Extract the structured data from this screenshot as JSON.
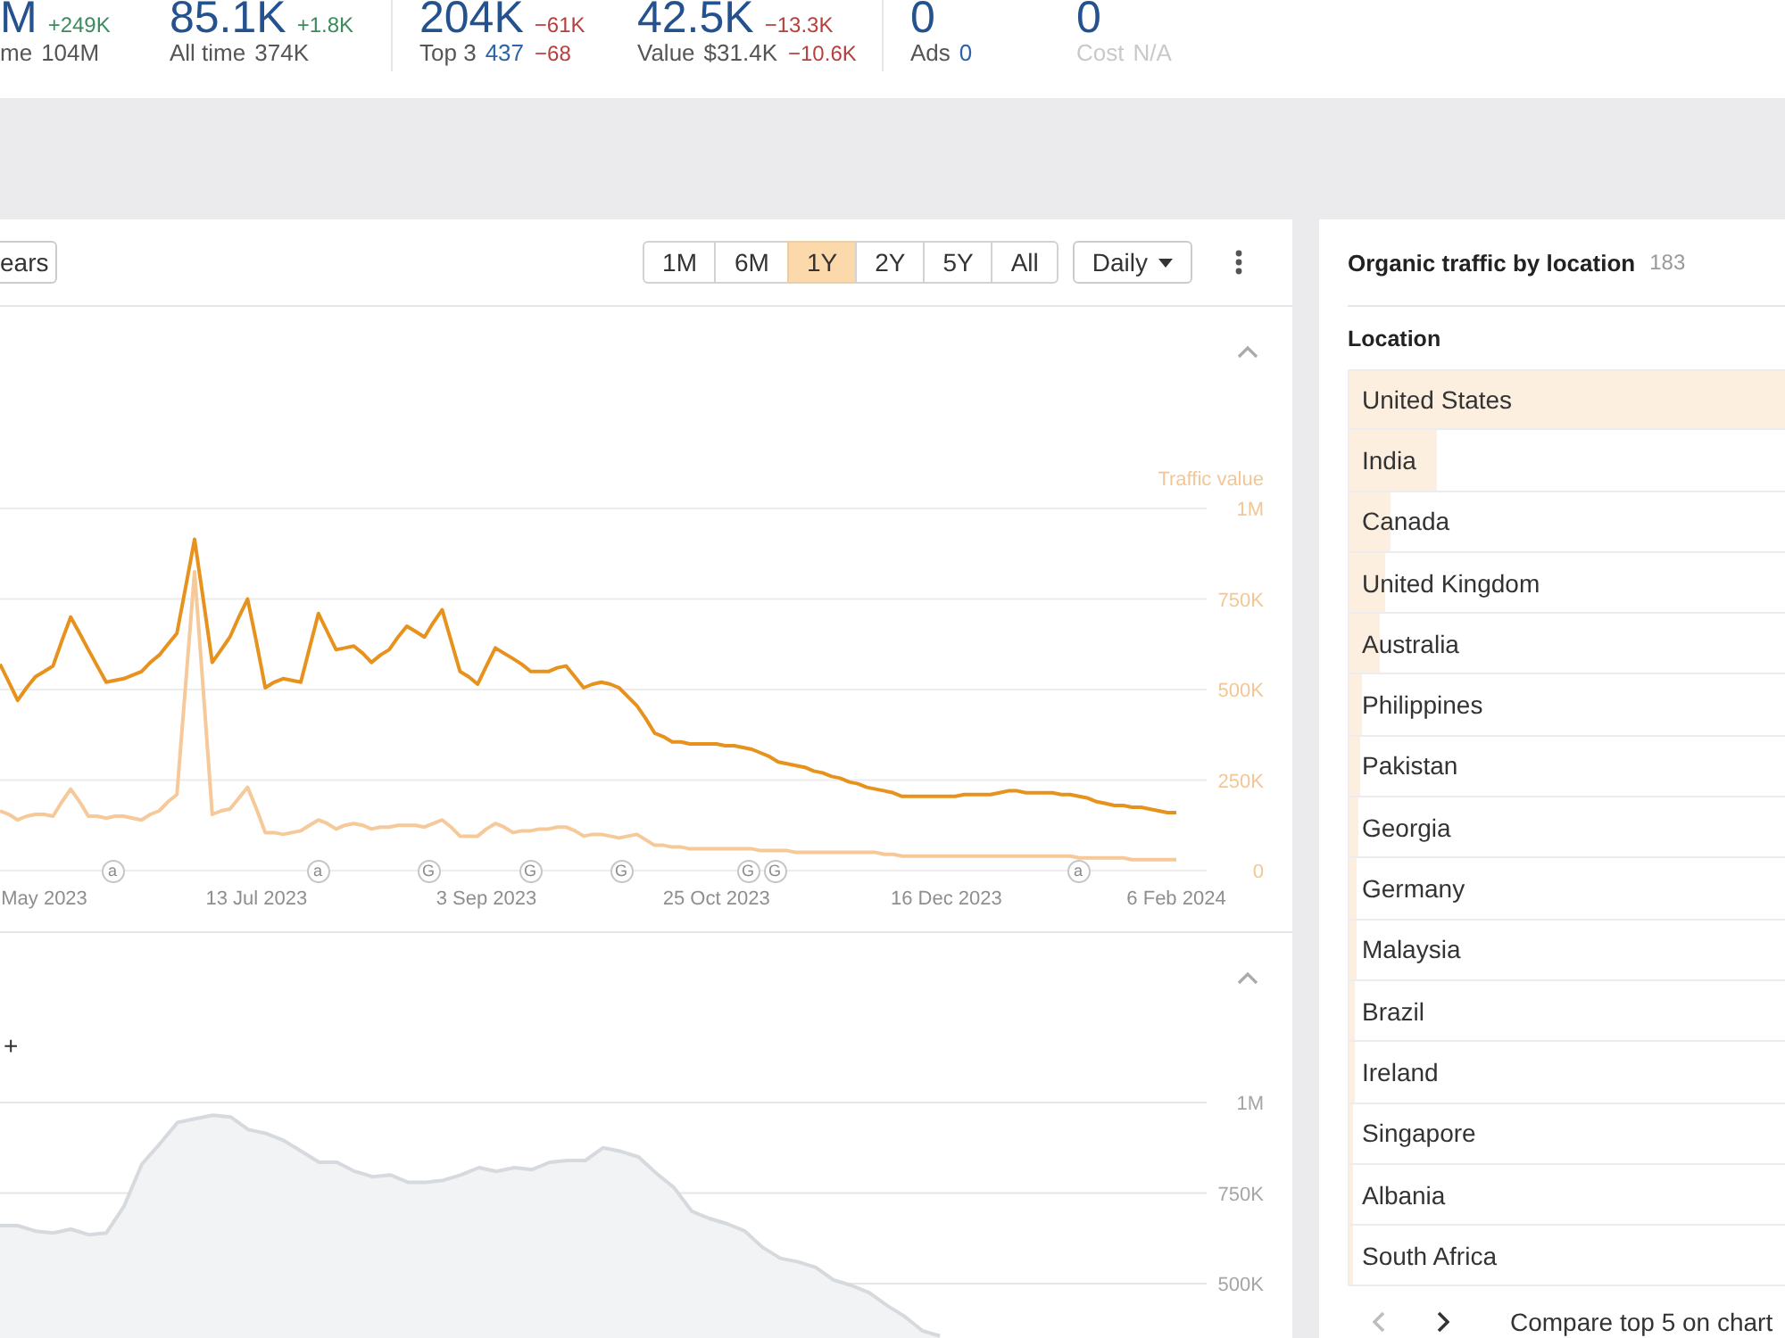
{
  "header": {
    "groups": [
      [
        {
          "value": "M",
          "change": "+249K",
          "increase": true,
          "label": "me",
          "detail": "104M",
          "detail_link": false,
          "disabled": false
        },
        {
          "value": "85.1K",
          "change": "+1.8K",
          "increase": true,
          "label": "All time",
          "detail": "374K",
          "detail_link": false,
          "disabled": false
        }
      ],
      [
        {
          "value": "204K",
          "change": "−61K",
          "increase": false,
          "label": "Top 3",
          "detail": "437",
          "detail_link": true,
          "detail_change": "−68",
          "disabled": false
        },
        {
          "value": "42.5K",
          "change": "−13.3K",
          "increase": false,
          "label": "Value",
          "detail": "$31.4K",
          "detail_link": false,
          "detail_change": "−10.6K",
          "disabled": false
        }
      ],
      [
        {
          "value": "0",
          "label": "Ads",
          "detail": "0",
          "detail_link": true,
          "disabled": false
        },
        {
          "value": "0",
          "label": "Cost",
          "detail": "N/A",
          "detail_link": false,
          "disabled": true
        }
      ]
    ]
  },
  "chart_panel": {
    "toolbar": {
      "period_button": "ears",
      "ranges": [
        {
          "label": "1M",
          "selected": false
        },
        {
          "label": "6M",
          "selected": false
        },
        {
          "label": "1Y",
          "selected": true
        },
        {
          "label": "2Y",
          "selected": false
        },
        {
          "label": "5Y",
          "selected": false
        },
        {
          "label": "All",
          "selected": false
        }
      ],
      "interval": "Daily"
    },
    "traffic_section": {
      "expanded": true,
      "update_markers": [
        {
          "text": "a"
        },
        {
          "text": "a"
        },
        {
          "text": "G"
        },
        {
          "text": "G"
        },
        {
          "text": "G"
        },
        {
          "text": "G"
        },
        {
          "text": "G"
        },
        {
          "text": "a"
        }
      ],
      "chart_data": {
        "type": "line",
        "ylabel": "Traffic value",
        "grid": true,
        "categories": [
          null,
          null,
          null,
          null,
          null,
          "May 2023",
          null,
          null,
          null,
          null,
          null,
          null,
          null,
          null,
          null,
          null,
          null,
          null,
          null,
          null,
          null,
          null,
          null,
          null,
          null,
          null,
          null,
          null,
          null,
          "13 Jul 2023",
          null,
          null,
          null,
          null,
          null,
          null,
          null,
          null,
          null,
          null,
          null,
          null,
          null,
          null,
          null,
          null,
          null,
          null,
          null,
          null,
          null,
          null,
          null,
          null,
          null,
          "3 Sep 2023",
          null,
          null,
          null,
          null,
          null,
          null,
          null,
          null,
          null,
          null,
          null,
          null,
          null,
          null,
          null,
          null,
          null,
          null,
          null,
          null,
          null,
          null,
          null,
          null,
          null,
          "25 Oct 2023",
          null,
          null,
          null,
          null,
          null,
          null,
          null,
          null,
          null,
          null,
          null,
          null,
          null,
          null,
          null,
          null,
          null,
          null,
          null,
          null,
          null,
          null,
          null,
          null,
          null,
          "16 Dec 2023",
          null,
          null,
          null,
          null,
          null,
          null,
          null,
          null,
          null,
          null,
          null,
          null,
          null,
          null,
          null,
          null,
          null,
          null,
          null,
          null,
          null,
          null,
          null,
          null,
          null,
          "6 Feb 2024"
        ],
        "ylim": [
          0,
          1000000
        ],
        "yticks": [
          {
            "value": 0,
            "label": "0"
          },
          {
            "value": 250000,
            "label": "250K"
          },
          {
            "value": 500000,
            "label": "500K"
          },
          {
            "value": 750000,
            "label": "750K"
          },
          {
            "value": 1000000,
            "label": "1M"
          }
        ],
        "series": [
          {
            "color": "#e8921e",
            "values": [
              570000,
              520000,
              470000,
              505000,
              535000,
              550000,
              565000,
              635000,
              700000,
              655000,
              610000,
              565000,
              520000,
              525000,
              530000,
              540000,
              550000,
              575000,
              595000,
              625000,
              655000,
              785000,
              915000,
              745000,
              575000,
              610000,
              645000,
              700000,
              750000,
              630000,
              505000,
              520000,
              530000,
              525000,
              520000,
              615000,
              710000,
              660000,
              610000,
              615000,
              620000,
              600000,
              575000,
              595000,
              610000,
              645000,
              675000,
              660000,
              645000,
              685000,
              720000,
              635000,
              550000,
              535000,
              515000,
              565000,
              615000,
              600000,
              585000,
              570000,
              550000,
              550000,
              550000,
              560000,
              565000,
              535000,
              505000,
              515000,
              520000,
              515000,
              505000,
              480000,
              455000,
              420000,
              380000,
              370000,
              355000,
              355000,
              350000,
              350000,
              350000,
              350000,
              345000,
              345000,
              340000,
              335000,
              325000,
              315000,
              300000,
              295000,
              290000,
              285000,
              275000,
              270000,
              260000,
              255000,
              245000,
              240000,
              230000,
              225000,
              220000,
              215000,
              205000,
              205000,
              205000,
              205000,
              205000,
              205000,
              205000,
              210000,
              210000,
              210000,
              210000,
              215000,
              220000,
              220000,
              215000,
              215000,
              215000,
              215000,
              210000,
              210000,
              205000,
              200000,
              190000,
              185000,
              180000,
              180000,
              175000,
              175000,
              170000,
              165000,
              160000,
              160000
            ]
          },
          {
            "color": "#f5c999",
            "values": [
              165000,
              155000,
              140000,
              150000,
              155000,
              155000,
              150000,
              190000,
              225000,
              190000,
              150000,
              150000,
              145000,
              150000,
              150000,
              145000,
              140000,
              155000,
              165000,
              190000,
              210000,
              520000,
              825000,
              490000,
              155000,
              165000,
              170000,
              200000,
              230000,
              170000,
              105000,
              105000,
              100000,
              105000,
              110000,
              125000,
              140000,
              130000,
              115000,
              125000,
              130000,
              125000,
              115000,
              120000,
              120000,
              125000,
              125000,
              125000,
              120000,
              130000,
              140000,
              120000,
              95000,
              95000,
              95000,
              115000,
              130000,
              120000,
              105000,
              110000,
              110000,
              115000,
              115000,
              120000,
              120000,
              110000,
              95000,
              100000,
              100000,
              95000,
              90000,
              95000,
              100000,
              85000,
              70000,
              70000,
              65000,
              65000,
              60000,
              60000,
              60000,
              60000,
              60000,
              60000,
              60000,
              60000,
              55000,
              55000,
              55000,
              55000,
              50000,
              50000,
              50000,
              50000,
              50000,
              50000,
              50000,
              50000,
              50000,
              50000,
              45000,
              45000,
              40000,
              40000,
              40000,
              40000,
              40000,
              40000,
              40000,
              40000,
              40000,
              40000,
              40000,
              40000,
              40000,
              40000,
              40000,
              40000,
              40000,
              40000,
              40000,
              40000,
              35000,
              35000,
              35000,
              35000,
              35000,
              35000,
              30000,
              30000,
              30000,
              30000,
              30000,
              30000
            ]
          }
        ]
      }
    },
    "area_section": {
      "expanded": true,
      "legend_fragment": "+",
      "chart_data": {
        "type": "area",
        "grid": true,
        "categories": [
          null,
          null,
          null,
          null,
          null,
          null,
          null,
          null,
          null,
          null,
          null,
          null,
          null,
          null,
          null,
          null,
          null,
          null,
          null,
          null,
          null,
          null,
          null,
          null,
          null,
          null,
          null,
          null,
          null,
          null,
          null,
          null,
          null,
          null,
          null,
          null,
          null,
          null,
          null,
          null,
          null,
          null,
          null,
          null,
          null,
          null,
          null,
          null,
          null,
          null,
          null,
          null,
          null,
          null
        ],
        "ylim": [
          0,
          1000000
        ],
        "yticks": [
          {
            "value": 500000,
            "label": "500K"
          },
          {
            "value": 750000,
            "label": "750K"
          },
          {
            "value": 1000000,
            "label": "1M"
          }
        ],
        "series": [
          {
            "color": "#d6d9de",
            "values": [
              660000,
              660000,
              645000,
              640000,
              650000,
              635000,
              640000,
              715000,
              830000,
              885000,
              945000,
              955000,
              965000,
              960000,
              925000,
              915000,
              895000,
              865000,
              835000,
              835000,
              810000,
              795000,
              800000,
              780000,
              780000,
              785000,
              800000,
              820000,
              810000,
              820000,
              815000,
              835000,
              840000,
              840000,
              875000,
              865000,
              850000,
              805000,
              765000,
              700000,
              680000,
              665000,
              645000,
              600000,
              570000,
              560000,
              545000,
              510000,
              495000,
              475000,
              440000,
              410000,
              370000,
              355000
            ]
          }
        ]
      }
    }
  },
  "location_panel": {
    "title": "Organic traffic by location",
    "count": "183",
    "column": "Location",
    "rows": [
      {
        "name": "United States",
        "level": 1
      },
      {
        "name": "India",
        "level": 0.2
      },
      {
        "name": "Canada",
        "level": 0.095
      },
      {
        "name": "United Kingdom",
        "level": 0.08
      },
      {
        "name": "Australia",
        "level": 0.07
      },
      {
        "name": "Philippines",
        "level": 0.03
      },
      {
        "name": "Pakistan",
        "level": 0.025
      },
      {
        "name": "Georgia",
        "level": 0.02
      },
      {
        "name": "Germany",
        "level": 0.018
      },
      {
        "name": "Malaysia",
        "level": 0.016
      },
      {
        "name": "Brazil",
        "level": 0.014
      },
      {
        "name": "Ireland",
        "level": 0.012
      },
      {
        "name": "Singapore",
        "level": 0.01
      },
      {
        "name": "Albania",
        "level": 0.01
      },
      {
        "name": "South Africa",
        "level": 0.008
      }
    ],
    "pager": [
      {
        "kind": "prev",
        "disabled": true
      },
      {
        "kind": "next",
        "disabled": false
      }
    ],
    "compare_link": "Compare top 5 on chart"
  }
}
